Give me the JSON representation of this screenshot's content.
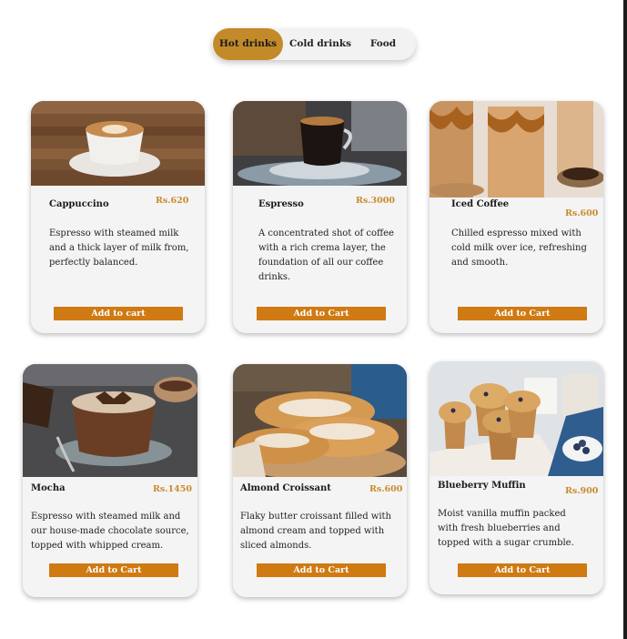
{
  "tabs": [
    "Hot drinks",
    "Cold drinks",
    "Food"
  ],
  "active_tab": "Hot drinks",
  "colors": {
    "accent": "#c38a2a",
    "price": "#c98a2a",
    "button": "#cf7a12",
    "card": "#f4f4f4"
  },
  "products": [
    {
      "name": "Cappuccino",
      "price": "Rs.620",
      "description": "Espresso with steamed milk and a thick layer of milk from, perfectly balanced.",
      "button": "Add to cart",
      "image": "cappuccino-photo"
    },
    {
      "name": "Espresso",
      "price": "Rs.3000",
      "description": "A concentrated shot of coffee with a rich crema layer, the foundation of all our coffee drinks.",
      "button": "Add to Cart",
      "image": "espresso-photo"
    },
    {
      "name": "Iced Coffee",
      "price": "Rs.600",
      "description": "Chilled espresso mixed with cold milk over ice, refreshing and smooth.",
      "button": "Add to Cart",
      "image": "iced-coffee-photo"
    },
    {
      "name": "Mocha",
      "price": "Rs.1450",
      "description": "Espresso with steamed milk and our house-made chocolate source, topped with whipped cream.",
      "button": "Add to Cart",
      "image": "mocha-photo"
    },
    {
      "name": "Almond Croissant",
      "price": "Rs.600",
      "description": "Flaky butter croissant filled with almond cream and topped with sliced almonds.",
      "button": "Add to Cart",
      "image": "croissant-photo"
    },
    {
      "name": "Blueberry Muffin",
      "price": "Rs.900",
      "description": "Moist vanilla muffin packed with fresh blueberries and topped with a sugar crumble.",
      "button": "Add to Cart",
      "image": "muffin-photo"
    }
  ]
}
